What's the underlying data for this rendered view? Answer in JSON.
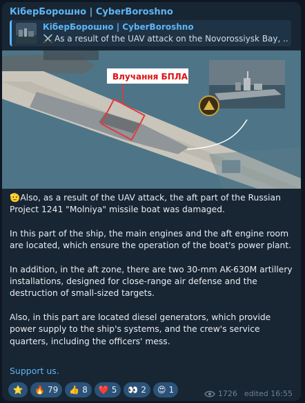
{
  "channel": {
    "name": "КіберБорошно | CyberBoroshno"
  },
  "reply": {
    "author": "КіберБорошно | CyberBoroshno",
    "text": "As a result of the UAV attack on the Novorossiysk Bay, ...",
    "emoji": "⚔️"
  },
  "image": {
    "label": "Влучання БПЛА"
  },
  "body": {
    "paragraphs": [
      "Also, as a result of the UAV attack, the aft part of the Russian Project 1241 \"Molniya\" missile boat was damaged.",
      "In this part of the ship, the main engines and the aft engine room are located, which ensure the operation of the boat's power plant.",
      "In addition, in the aft zone, there are two 30-mm AK-630M artillery installations, designed for close-range air defense and the destruction of small-sized targets.",
      "Also, in this part are located diesel generators, which provide power supply to the ship's systems, and the crew's service quarters, including the officers' mess."
    ],
    "lead_emoji": "🫡"
  },
  "support_link": "Support us.",
  "reactions": [
    {
      "emoji": "⭐",
      "count": ""
    },
    {
      "emoji": "🔥",
      "count": "79"
    },
    {
      "emoji": "👍",
      "count": "8"
    },
    {
      "emoji": "❤️",
      "count": "5"
    },
    {
      "emoji": "👀",
      "count": "2"
    },
    {
      "emoji": "😍",
      "count": "1"
    }
  ],
  "meta": {
    "views": "1726",
    "edited": "edited 16:55"
  },
  "colors": {
    "bubble": "#182533",
    "accent": "#5fb5f3",
    "reaction_bg": "#2b5278",
    "highlight": "#e23b3b"
  }
}
